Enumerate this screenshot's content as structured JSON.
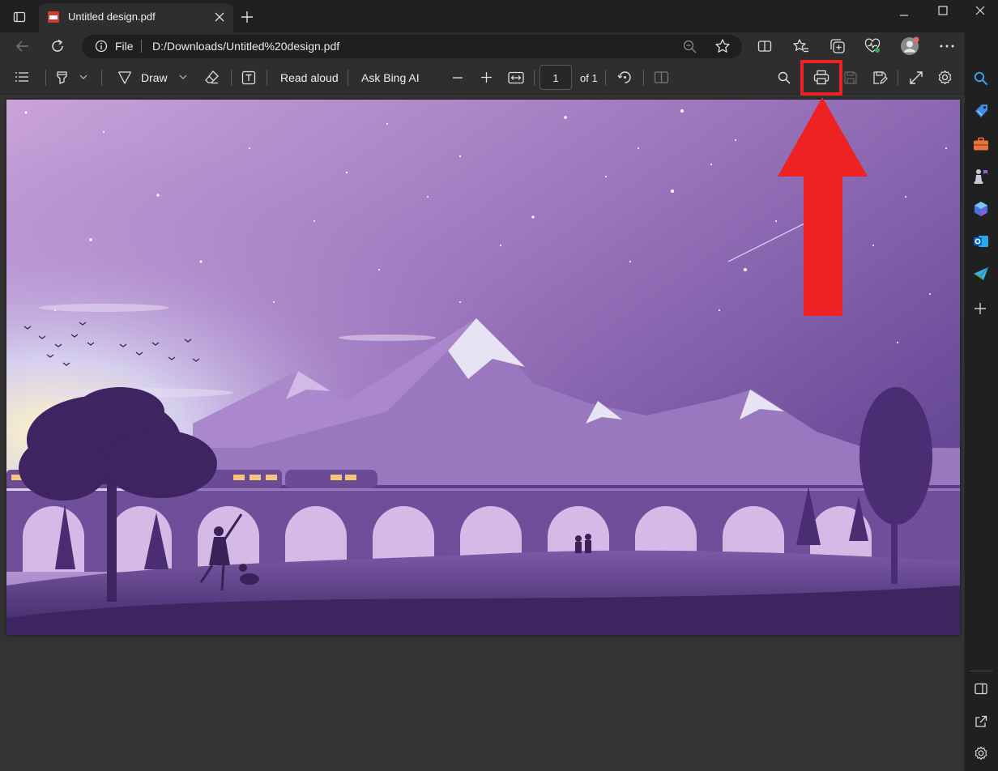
{
  "window": {
    "tab_title": "Untitled design.pdf",
    "tab_favicon_text": "PDF"
  },
  "address_bar": {
    "scheme_label": "File",
    "url": "D:/Downloads/Untitled%20design.pdf"
  },
  "pdf_toolbar": {
    "draw_label": "Draw",
    "read_aloud_label": "Read aloud",
    "ask_bing_label": "Ask Bing AI",
    "page_number": "1",
    "page_total_label": "of 1"
  },
  "colors": {
    "annotation_red": "#ee2222",
    "page_bg": "#333333",
    "toolbar_bg": "#2e2e2e"
  },
  "icons": {
    "titlebar": [
      "tab-actions-icon",
      "pdf-favicon-icon",
      "close-tab-icon",
      "new-tab-icon",
      "minimize-icon",
      "maximize-icon",
      "close-window-icon"
    ],
    "navbar": [
      "back-icon",
      "refresh-icon",
      "info-icon",
      "zoom-out-icon",
      "favorite-star-icon",
      "split-screen-icon",
      "favorites-icon",
      "collections-icon",
      "browser-essentials-icon",
      "profile-avatar-icon",
      "more-icon",
      "copilot-icon"
    ],
    "pdf_toolbar": [
      "contents-icon",
      "highlight-icon",
      "chevron-down-icon",
      "draw-icon",
      "eraser-icon",
      "add-text-icon",
      "zoom-out-icon",
      "zoom-in-icon",
      "fit-page-icon",
      "rotate-icon",
      "page-view-icon",
      "search-icon",
      "print-icon",
      "save-icon",
      "save-as-icon",
      "fullscreen-icon",
      "settings-icon"
    ],
    "sidebar": [
      "search-icon",
      "shopping-tag-icon",
      "tools-icon",
      "games-icon",
      "microsoft-365-icon",
      "outlook-icon",
      "send-icon",
      "add-icon",
      "hide-sidebar-icon",
      "external-link-icon",
      "sidebar-settings-icon"
    ]
  }
}
